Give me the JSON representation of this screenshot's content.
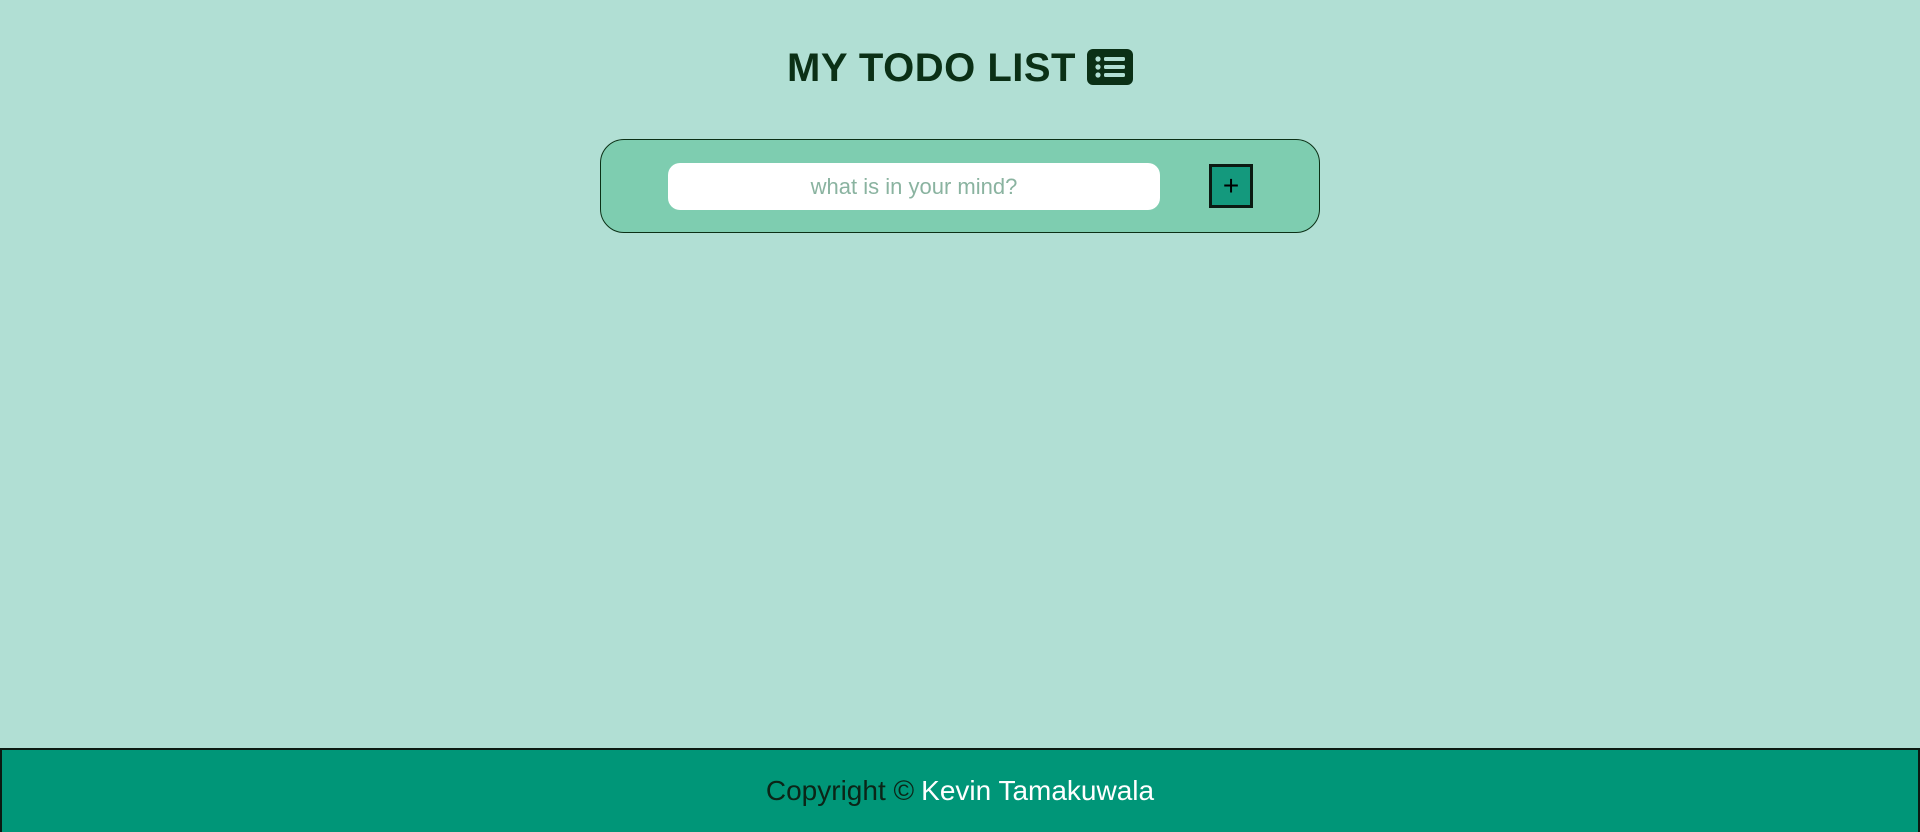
{
  "header": {
    "title": "MY TODO LIST",
    "icon": "list-icon"
  },
  "form": {
    "input_placeholder": "what is in your mind?",
    "input_value": "",
    "add_button_label": "+"
  },
  "footer": {
    "copyright_label": "Copyright ©",
    "author": "Kevin Tamakuwala"
  },
  "colors": {
    "background": "#b1dfd4",
    "card": "#7ecdb0",
    "button": "#14997d",
    "footer": "#009678",
    "title": "#0b3016"
  }
}
